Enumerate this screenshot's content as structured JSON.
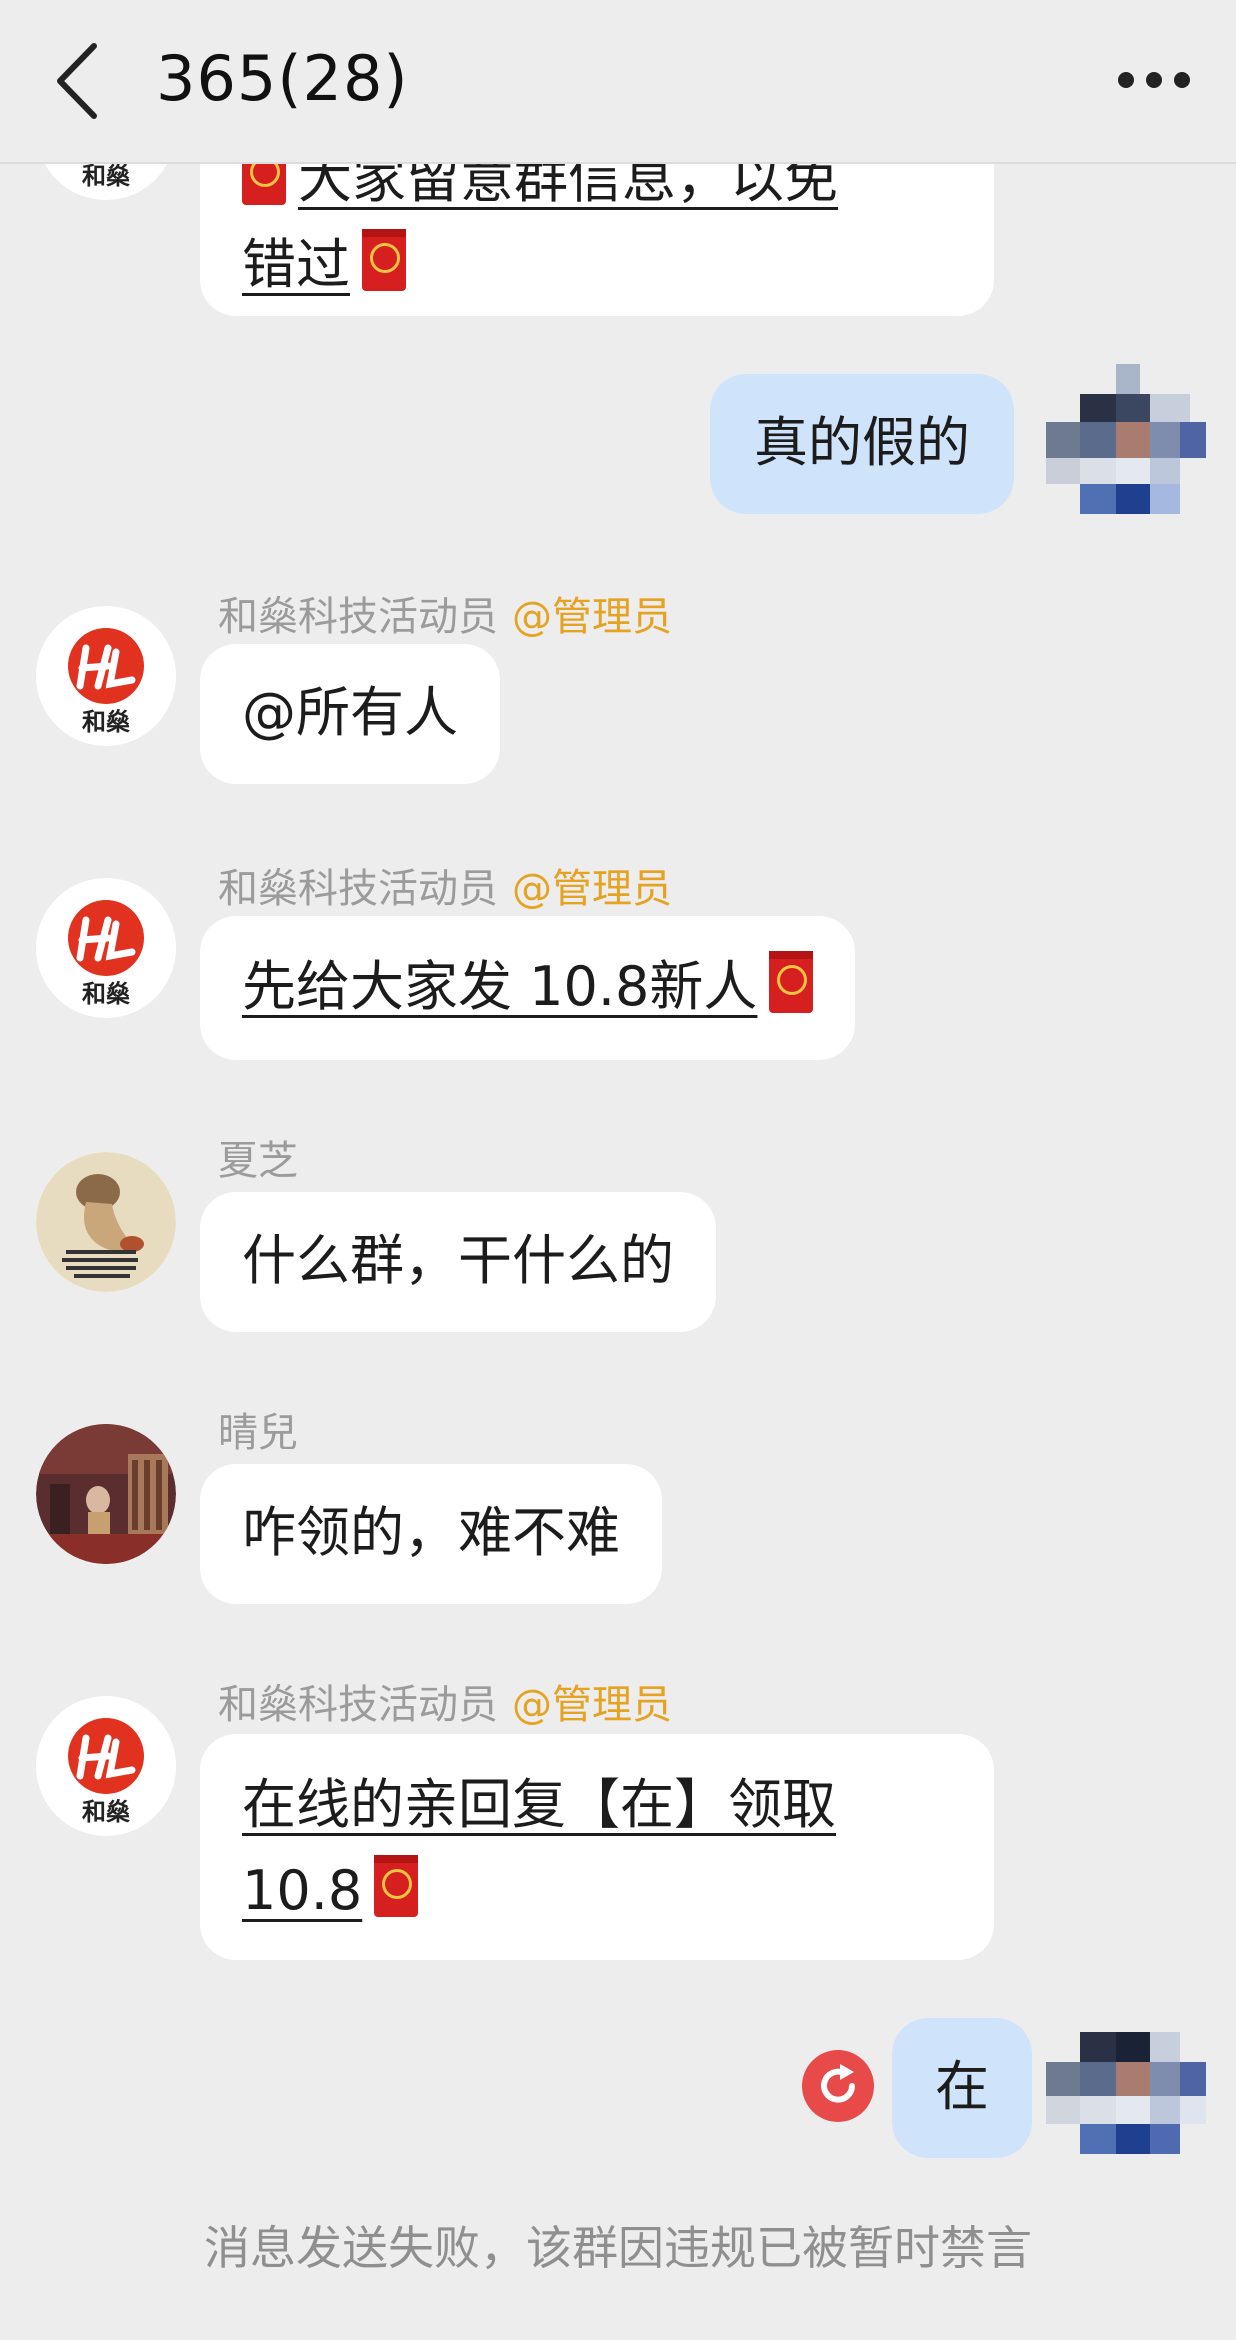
{
  "header": {
    "title": "365(28)"
  },
  "messages": {
    "m0": {
      "line1": "大家留意群信息，以免",
      "line2": "错过"
    },
    "m1": {
      "text": "真的假的"
    },
    "m2": {
      "sender": "和燊科技活动员",
      "role": "@管理员",
      "text": "@所有人"
    },
    "m3": {
      "sender": "和燊科技活动员",
      "role": "@管理员",
      "text": "先给大家发 10.8新人"
    },
    "m4": {
      "sender": "夏芝",
      "text": "什么群，干什么的"
    },
    "m5": {
      "sender": "晴兒",
      "text": "咋领的，难不难"
    },
    "m6": {
      "sender": "和燊科技活动员",
      "role": "@管理员",
      "line1": "在线的亲回复【在】领取",
      "line2": "10.8"
    },
    "m7": {
      "text": "在"
    }
  },
  "avatar_label": "和燊",
  "status": {
    "text": "消息发送失败，该群因违规已被暂时禁言"
  },
  "colors": {
    "background": "#ededed",
    "self_bubble": "#cfe4fb",
    "role_tag": "#e6a221",
    "red_packet": "#d61f1f",
    "retry": "#e84a4a"
  }
}
